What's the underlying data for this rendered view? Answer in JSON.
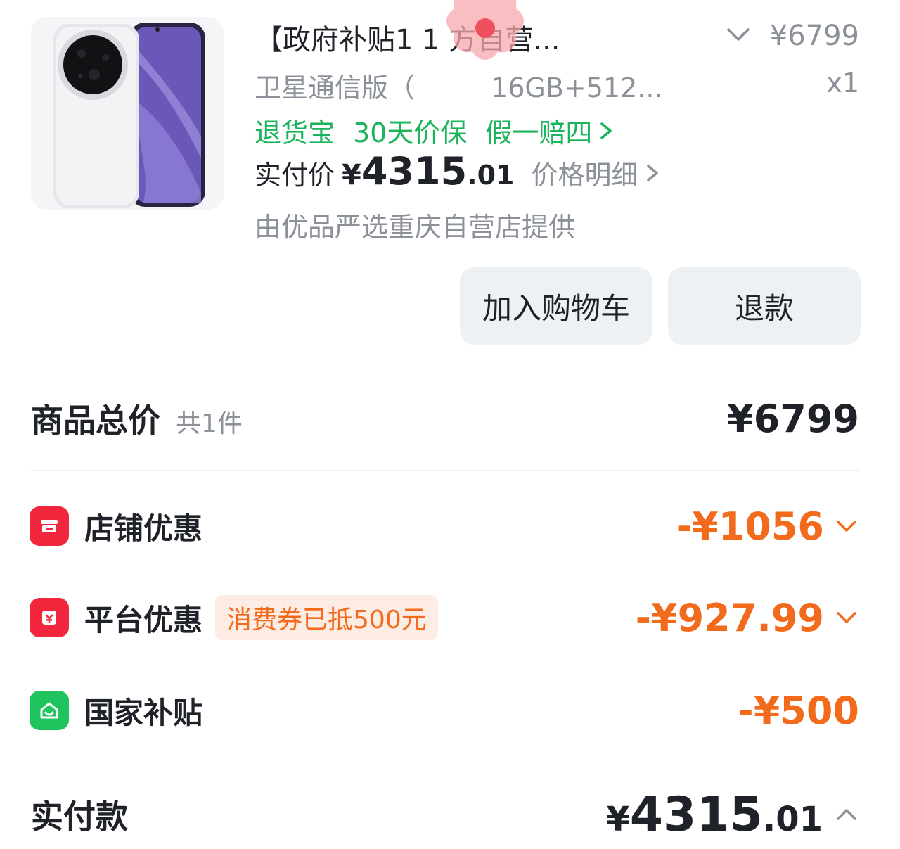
{
  "product": {
    "image_icon": "phone-product-image",
    "title": "【政府补贴1 1 方自营...",
    "unit_price": "¥6799",
    "spec": "卫星通信版（",
    "spec_tail": "16GB+512...",
    "qty": "x1",
    "tags": [
      "退货宝",
      "30天价保",
      "假一赔四"
    ],
    "paid_label": "实付价",
    "paid_currency": "¥",
    "paid_int": "4315",
    "paid_dec": ".01",
    "price_detail": "价格明细",
    "seller": "由优品严选重庆自营店提供"
  },
  "actions": {
    "add_to_cart": "加入购物车",
    "refund": "退款"
  },
  "summary": {
    "total_label": "商品总价",
    "total_count": "共1件",
    "total_value": "¥6799",
    "discounts": [
      {
        "icon": "store-icon",
        "label": "店铺优惠",
        "badge": "",
        "value": "-¥1056",
        "icon_color": "#f2263c"
      },
      {
        "icon": "gift-icon",
        "label": "平台优惠",
        "badge": "消费券已抵500元",
        "value": "-¥927.99",
        "icon_color": "#f2263c"
      },
      {
        "icon": "home-subsidy-icon",
        "label": "国家补贴",
        "badge": "",
        "value": "-¥500",
        "icon_color": "#1fc45e"
      }
    ],
    "final_label": "实付款",
    "final_currency": "¥",
    "final_int": "4315",
    "final_dec": ".01"
  },
  "colors": {
    "green": "#1bb45a",
    "orange": "#f26b1d",
    "red": "#f2263c",
    "gray": "#8b9099"
  }
}
